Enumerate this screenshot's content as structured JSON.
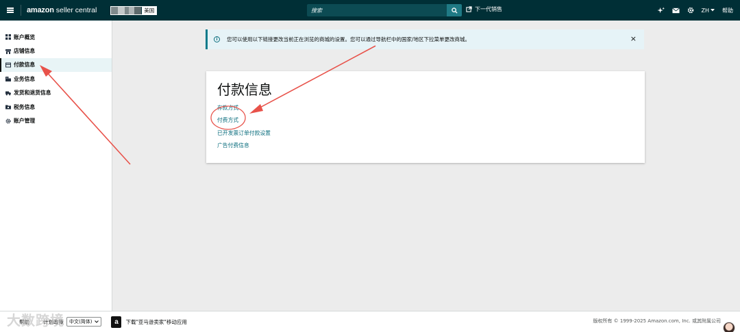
{
  "topbar": {
    "logo_amazon": "amazon",
    "logo_seller_central": "seller central",
    "store_region": "美国",
    "search_placeholder": "搜索",
    "next_gen_label": "下一代销售",
    "lang_label": "ZH",
    "help_label": "帮助"
  },
  "sidebar": {
    "items": [
      {
        "label": "账户概览",
        "icon": "grid-icon"
      },
      {
        "label": "店铺信息",
        "icon": "store-icon"
      },
      {
        "label": "付款信息",
        "icon": "card-icon",
        "active": true
      },
      {
        "label": "业务信息",
        "icon": "building-icon"
      },
      {
        "label": "发货和退货信息",
        "icon": "truck-icon"
      },
      {
        "label": "税务信息",
        "icon": "folder-icon"
      },
      {
        "label": "账户管理",
        "icon": "gear-icon"
      }
    ]
  },
  "banner": {
    "text": "您可以使用以下链接更改当前正在浏览的商城的设置。您可以通过导航栏中的国家/地区下拉菜单更改商城。",
    "close": "×"
  },
  "card": {
    "title": "付款信息",
    "links": [
      "存款方式",
      "付费方式",
      "已开发票订单付款设置",
      "广告付费信息"
    ]
  },
  "footer": {
    "help": "帮助",
    "policy": "计划政策",
    "language": "中文(简体)",
    "app_promo": "下载\"亚马逊卖家\"移动应用",
    "copyright": "版权所有 © 1999-2025 Amazon.com, Inc. 或其附属公司"
  },
  "overlay": {
    "watermark": "大数跨境"
  },
  "colors": {
    "topbar_bg": "#002f36",
    "link": "#0a6d7d",
    "annotation_red": "#e8524a"
  }
}
